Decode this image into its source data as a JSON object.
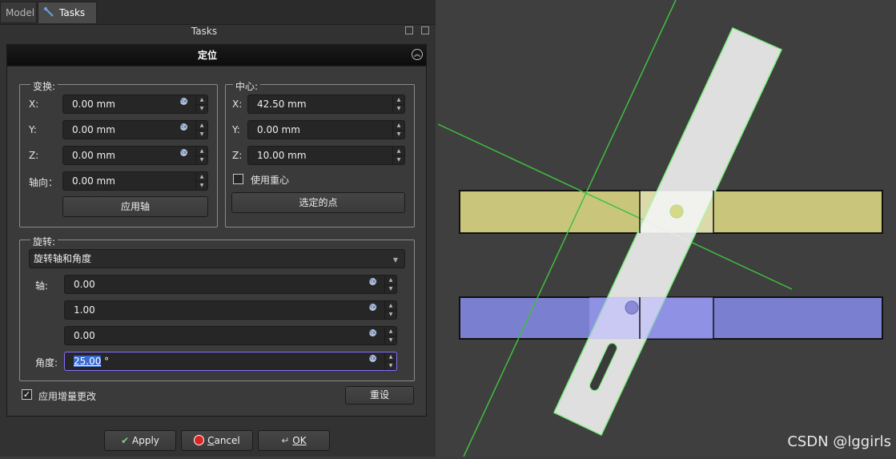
{
  "tabs": {
    "model": "Model",
    "tasks": "Tasks"
  },
  "panel_title": "Tasks",
  "dialog": {
    "title": "定位",
    "transform": {
      "title": "变换:",
      "x_label": "X:",
      "x_value": "0.00 mm",
      "y_label": "Y:",
      "y_value": "0.00 mm",
      "z_label": "Z:",
      "z_value": "0.00 mm",
      "axial_label": "轴向：",
      "axial_value": "0.00 mm",
      "apply_axial_button": "应用轴"
    },
    "center": {
      "title": "中心:",
      "x_label": "X:",
      "x_value": "42.50 mm",
      "y_label": "Y:",
      "y_value": "0.00 mm",
      "z_label": "Z:",
      "z_value": "10.00 mm",
      "use_center_of_mass_label": "使用重心",
      "use_center_of_mass_checked": false,
      "selected_points_button": "选定的点"
    },
    "rotation": {
      "title": "旋转:",
      "mode": "旋转轴和角度",
      "axis_label": "轴:",
      "axis_x": "0.00",
      "axis_y": "1.00",
      "axis_z": "0.00",
      "angle_label": "角度:",
      "angle_value_selected": "25.00",
      "angle_unit": " °"
    },
    "incremental_label": "应用增量更改",
    "incremental_checked": true,
    "reset_button": "重设"
  },
  "buttons": {
    "apply": "Apply",
    "cancel_mnemonic": "C",
    "cancel_rest": "ancel",
    "ok": "OK"
  },
  "watermark": "CSDN @lggirls",
  "colors": {
    "axis_line": "#3fbf3f",
    "yellow_body": "#c9c67c",
    "blue_body": "#7b7fd0",
    "white_bar": "#ededed",
    "selection": "#3b6ad0"
  }
}
